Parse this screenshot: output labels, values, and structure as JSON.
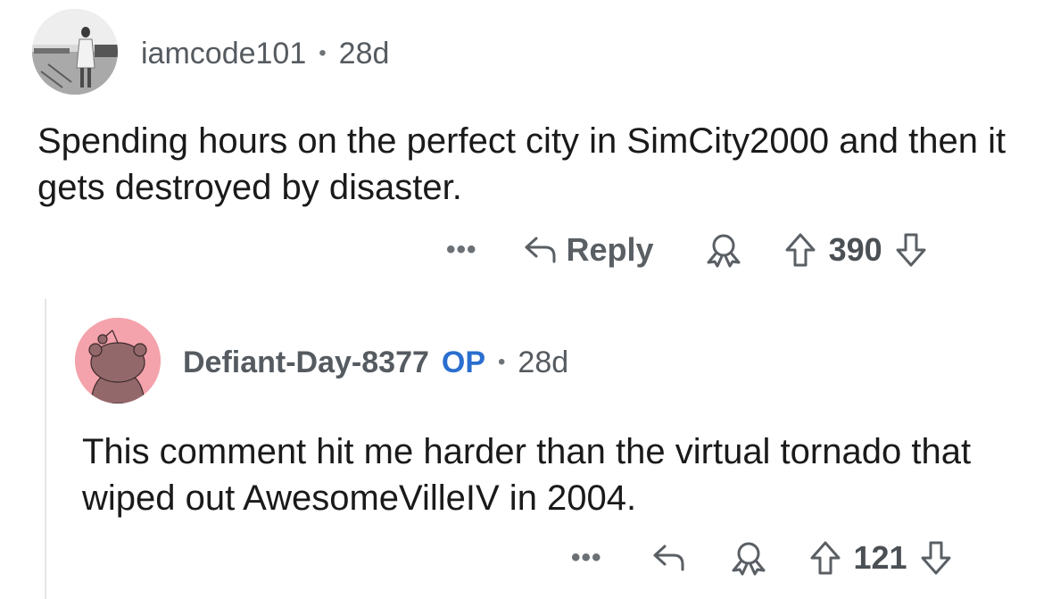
{
  "comments": [
    {
      "author": "iamcode101",
      "separator": "•",
      "age": "28d",
      "body": "Spending hours on the perfect city in SimCity2000 and then it gets destroyed by disaster.",
      "actions": {
        "more_label": "•••",
        "reply_label": "Reply",
        "score": "390"
      }
    },
    {
      "author": "Defiant-Day-8377",
      "op_badge": "OP",
      "separator": "•",
      "age": "28d",
      "body": "This comment hit me harder than the virtual tornado that wiped out AwesomeVilleIV in 2004.",
      "actions": {
        "more_label": "•••",
        "score": "121"
      }
    }
  ],
  "icons": {
    "reply": "reply-arrow-icon",
    "award": "award-icon",
    "upvote": "upvote-arrow-icon",
    "downvote": "downvote-arrow-icon"
  },
  "colors": {
    "op_badge": "#2a6fcf",
    "meta_text": "#555b60",
    "avatar2_bg": "#f4a2ab",
    "thread_line": "#e4e6e8"
  }
}
